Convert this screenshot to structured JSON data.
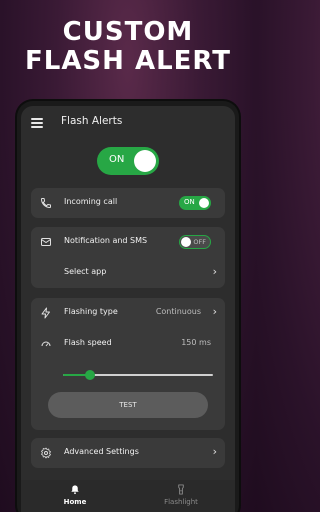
{
  "promo": {
    "line1": "CUSTOM",
    "line2": "FLASH ALERT"
  },
  "app": {
    "title": "Flash Alerts",
    "master_toggle_label": "ON",
    "master_toggle_on": true
  },
  "incoming_call": {
    "label": "Incoming call",
    "switch_label": "ON",
    "enabled": true,
    "icon": "phone-icon"
  },
  "notification": {
    "label": "Notification and SMS",
    "switch_label": "OFF",
    "enabled": false,
    "icon": "envelope-icon",
    "select_app_label": "Select app"
  },
  "flashing": {
    "type_label": "Flashing type",
    "type_value": "Continuous",
    "type_icon": "lightning-icon",
    "speed_label": "Flash speed",
    "speed_value": "150 ms",
    "speed_icon": "speedometer-icon",
    "slider_level": 0.18,
    "test_label": "TEST"
  },
  "advanced": {
    "label": "Advanced Settings",
    "icon": "gear-icon"
  },
  "bottom_nav": [
    {
      "label": "Home",
      "icon": "bell-icon",
      "active": true
    },
    {
      "label": "Flashlight",
      "icon": "flashlight-icon",
      "active": false
    }
  ],
  "colors": {
    "accent": "#27a745",
    "card": "#3a3a3a",
    "screen": "#2d2d2d",
    "background": "#3a1a35"
  }
}
